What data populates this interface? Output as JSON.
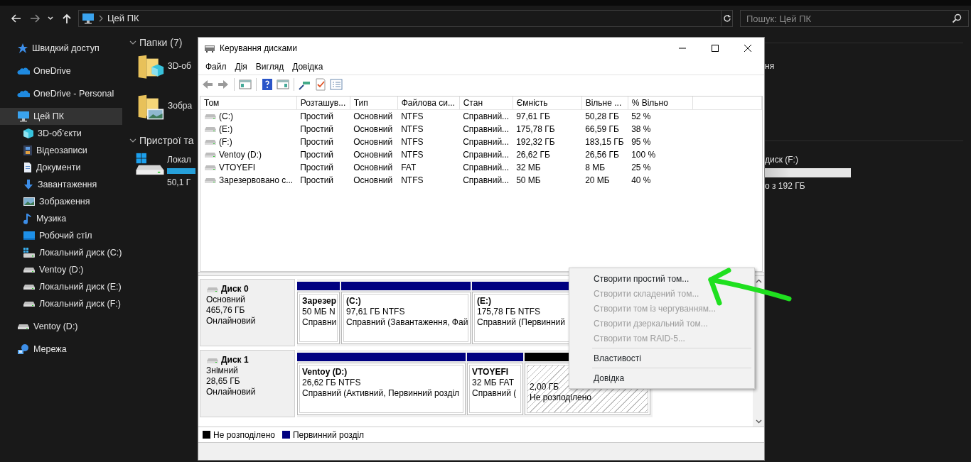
{
  "explorer": {
    "nav": {
      "address": "Цей ПК",
      "search_placeholder": "Пошук: Цей ПК"
    },
    "sidebar": {
      "items": [
        {
          "label": "Швидкий доступ",
          "selected": false
        },
        {
          "label": "OneDrive",
          "selected": false
        },
        {
          "label": "OneDrive - Personal",
          "selected": false
        },
        {
          "label": "Цей ПК",
          "selected": true,
          "children": [
            {
              "label": "3D-об’єкти",
              "selected": false
            },
            {
              "label": "Відеозаписи",
              "selected": false
            },
            {
              "label": "Документи",
              "selected": false
            },
            {
              "label": "Завантаження",
              "selected": false
            },
            {
              "label": "Зображення",
              "selected": false
            },
            {
              "label": "Музика",
              "selected": false
            },
            {
              "label": "Робочий стіл",
              "selected": false
            },
            {
              "label": "Локальний диск (C:)",
              "selected": false
            },
            {
              "label": "Ventoy (D:)",
              "selected": false
            },
            {
              "label": "Локальний диск (E:)",
              "selected": false
            },
            {
              "label": "Локальний диск (F:)",
              "selected": false
            }
          ]
        },
        {
          "label": "Ventoy (D:)",
          "selected": false
        },
        {
          "label": "Мережа",
          "selected": false
        }
      ]
    },
    "groups": [
      {
        "title": "Папки (7)",
        "items": [
          {
            "label": "3D-об"
          },
          {
            "label": "Зобра"
          }
        ]
      },
      {
        "title": "Пристрої та",
        "items": [
          {
            "label": "Локал",
            "detail": "50,1 Г"
          }
        ]
      }
    ],
    "right_column": {
      "folder_text": "ня",
      "drive_label": "диск (F:)",
      "drive_detail": "о з 192 ГБ"
    }
  },
  "window": {
    "title": "Керування дисками",
    "menu": [
      "Файл",
      "Дія",
      "Вигляд",
      "Довідка"
    ],
    "table": {
      "columns": [
        "Том",
        "Розташув...",
        "Тип",
        "Файлова си...",
        "Стан",
        "Ємність",
        "Вільне ...",
        "% Вільно"
      ],
      "rows": [
        [
          "(C:)",
          "Простий",
          "Основний",
          "NTFS",
          "Справний...",
          "97,61 ГБ",
          "50,28 ГБ",
          "52 %"
        ],
        [
          "(E:)",
          "Простий",
          "Основний",
          "NTFS",
          "Справний...",
          "175,78 ГБ",
          "66,59 ГБ",
          "38 %"
        ],
        [
          "(F:)",
          "Простий",
          "Основний",
          "NTFS",
          "Справний...",
          "192,32 ГБ",
          "183,15 ГБ",
          "95 %"
        ],
        [
          "Ventoy (D:)",
          "Простий",
          "Основний",
          "NTFS",
          "Справний...",
          "26,62 ГБ",
          "26,56 ГБ",
          "100 %"
        ],
        [
          "VTOYEFI",
          "Простий",
          "Основний",
          "FAT",
          "Справний...",
          "32 МБ",
          "8 МБ",
          "25 %"
        ],
        [
          "Зарезервовано с...",
          "Простий",
          "Основний",
          "NTFS",
          "Справний...",
          "50 МБ",
          "20 МБ",
          "40 %"
        ]
      ]
    },
    "disks": [
      {
        "name": "Диск 0",
        "type": "Основний",
        "size": "465,76 ГБ",
        "status": "Онлайновий",
        "partitions": [
          {
            "kind": "primary",
            "color": "#000080",
            "name": "Зарезер",
            "size": "50 МБ N",
            "status": "Справни"
          },
          {
            "kind": "primary",
            "color": "#000080",
            "name": "(C:)",
            "size": "97,61 ГБ NTFS",
            "status": "Справний (Завантаження, Фай"
          },
          {
            "kind": "primary",
            "color": "#000080",
            "name": "(E:)",
            "size": "175,78 ГБ NTFS",
            "status": "Справний (Первинний"
          }
        ]
      },
      {
        "name": "Диск 1",
        "type": "Знімний",
        "size": "28,65 ГБ",
        "status": "Онлайновий",
        "partitions": [
          {
            "kind": "primary",
            "color": "#000080",
            "name": "Ventoy  (D:)",
            "size": "26,62 ГБ NTFS",
            "status": "Справний (Активний, Первинний розділ"
          },
          {
            "kind": "primary",
            "color": "#000080",
            "name": "VTOYEFI",
            "size": "32 МБ FAT",
            "status": "Справний ("
          },
          {
            "kind": "unallocated",
            "color": "#000000",
            "size": "2,00 ГБ",
            "status": "Не розподілено"
          }
        ]
      }
    ],
    "legend": [
      {
        "color": "#000000",
        "label": "Не розподілено"
      },
      {
        "color": "#000080",
        "label": "Первинний розділ"
      }
    ]
  },
  "context_menu": {
    "items": [
      {
        "kind": "item",
        "label": "Створити простий том...",
        "disabled": false
      },
      {
        "kind": "item",
        "label": "Створити складений том...",
        "disabled": true
      },
      {
        "kind": "item",
        "label": "Створити том із чергуванням...",
        "disabled": true
      },
      {
        "kind": "item",
        "label": "Створити дзеркальний том...",
        "disabled": true
      },
      {
        "kind": "item",
        "label": "Створити том RAID-5...",
        "disabled": true
      },
      {
        "kind": "separator"
      },
      {
        "kind": "item",
        "label": "Властивості",
        "disabled": false
      },
      {
        "kind": "separator"
      },
      {
        "kind": "item",
        "label": "Довідка",
        "disabled": false
      }
    ]
  }
}
